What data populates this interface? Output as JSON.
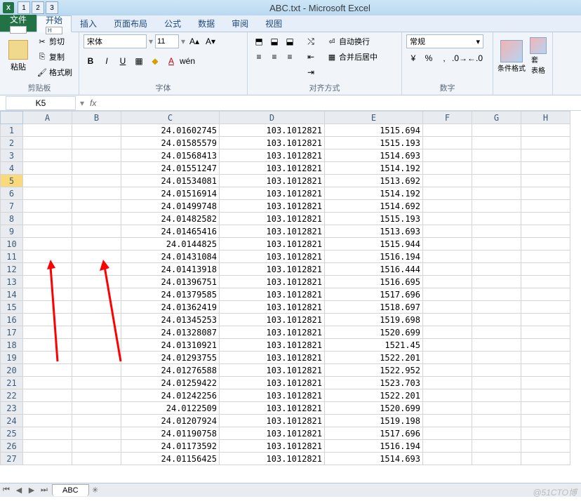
{
  "title": "ABC.txt - Microsoft Excel",
  "qat": [
    "1",
    "2",
    "3"
  ],
  "tabs": {
    "file": "文件",
    "file_hint": "F",
    "home": "开始",
    "home_hint": "H",
    "insert": "插入",
    "layout": "页面布局",
    "formulas": "公式",
    "data": "数据",
    "review": "审阅",
    "view": "视图"
  },
  "clipboard": {
    "paste": "粘贴",
    "cut": "剪切",
    "copy": "复制",
    "format_painter": "格式刷",
    "group": "剪贴板"
  },
  "font": {
    "name": "宋体",
    "size": "11",
    "group": "字体"
  },
  "alignment": {
    "wrap": "自动换行",
    "merge": "合并后居中",
    "group": "对齐方式"
  },
  "number": {
    "format": "常规",
    "group": "数字"
  },
  "styles": {
    "cond_format": "条件格式",
    "cell_styles": "套\n表格"
  },
  "cell_ref": "K5",
  "columns": [
    "A",
    "B",
    "C",
    "D",
    "E",
    "F",
    "G",
    "H"
  ],
  "rows": [
    {
      "r": 1,
      "c": "24.01602745",
      "d": "103.1012821",
      "e": "1515.694"
    },
    {
      "r": 2,
      "c": "24.01585579",
      "d": "103.1012821",
      "e": "1515.193"
    },
    {
      "r": 3,
      "c": "24.01568413",
      "d": "103.1012821",
      "e": "1514.693"
    },
    {
      "r": 4,
      "c": "24.01551247",
      "d": "103.1012821",
      "e": "1514.192"
    },
    {
      "r": 5,
      "c": "24.01534081",
      "d": "103.1012821",
      "e": "1513.692"
    },
    {
      "r": 6,
      "c": "24.01516914",
      "d": "103.1012821",
      "e": "1514.192"
    },
    {
      "r": 7,
      "c": "24.01499748",
      "d": "103.1012821",
      "e": "1514.692"
    },
    {
      "r": 8,
      "c": "24.01482582",
      "d": "103.1012821",
      "e": "1515.193"
    },
    {
      "r": 9,
      "c": "24.01465416",
      "d": "103.1012821",
      "e": "1513.693"
    },
    {
      "r": 10,
      "c": "24.0144825",
      "d": "103.1012821",
      "e": "1515.944"
    },
    {
      "r": 11,
      "c": "24.01431084",
      "d": "103.1012821",
      "e": "1516.194"
    },
    {
      "r": 12,
      "c": "24.01413918",
      "d": "103.1012821",
      "e": "1516.444"
    },
    {
      "r": 13,
      "c": "24.01396751",
      "d": "103.1012821",
      "e": "1516.695"
    },
    {
      "r": 14,
      "c": "24.01379585",
      "d": "103.1012821",
      "e": "1517.696"
    },
    {
      "r": 15,
      "c": "24.01362419",
      "d": "103.1012821",
      "e": "1518.697"
    },
    {
      "r": 16,
      "c": "24.01345253",
      "d": "103.1012821",
      "e": "1519.698"
    },
    {
      "r": 17,
      "c": "24.01328087",
      "d": "103.1012821",
      "e": "1520.699"
    },
    {
      "r": 18,
      "c": "24.01310921",
      "d": "103.1012821",
      "e": "1521.45"
    },
    {
      "r": 19,
      "c": "24.01293755",
      "d": "103.1012821",
      "e": "1522.201"
    },
    {
      "r": 20,
      "c": "24.01276588",
      "d": "103.1012821",
      "e": "1522.952"
    },
    {
      "r": 21,
      "c": "24.01259422",
      "d": "103.1012821",
      "e": "1523.703"
    },
    {
      "r": 22,
      "c": "24.01242256",
      "d": "103.1012821",
      "e": "1522.201"
    },
    {
      "r": 23,
      "c": "24.0122509",
      "d": "103.1012821",
      "e": "1520.699"
    },
    {
      "r": 24,
      "c": "24.01207924",
      "d": "103.1012821",
      "e": "1519.198"
    },
    {
      "r": 25,
      "c": "24.01190758",
      "d": "103.1012821",
      "e": "1517.696"
    },
    {
      "r": 26,
      "c": "24.01173592",
      "d": "103.1012821",
      "e": "1516.194"
    },
    {
      "r": 27,
      "c": "24.01156425",
      "d": "103.1012821",
      "e": "1514.693"
    }
  ],
  "active_row": 5,
  "sheet_name": "ABC",
  "watermark": "@51CTO博"
}
